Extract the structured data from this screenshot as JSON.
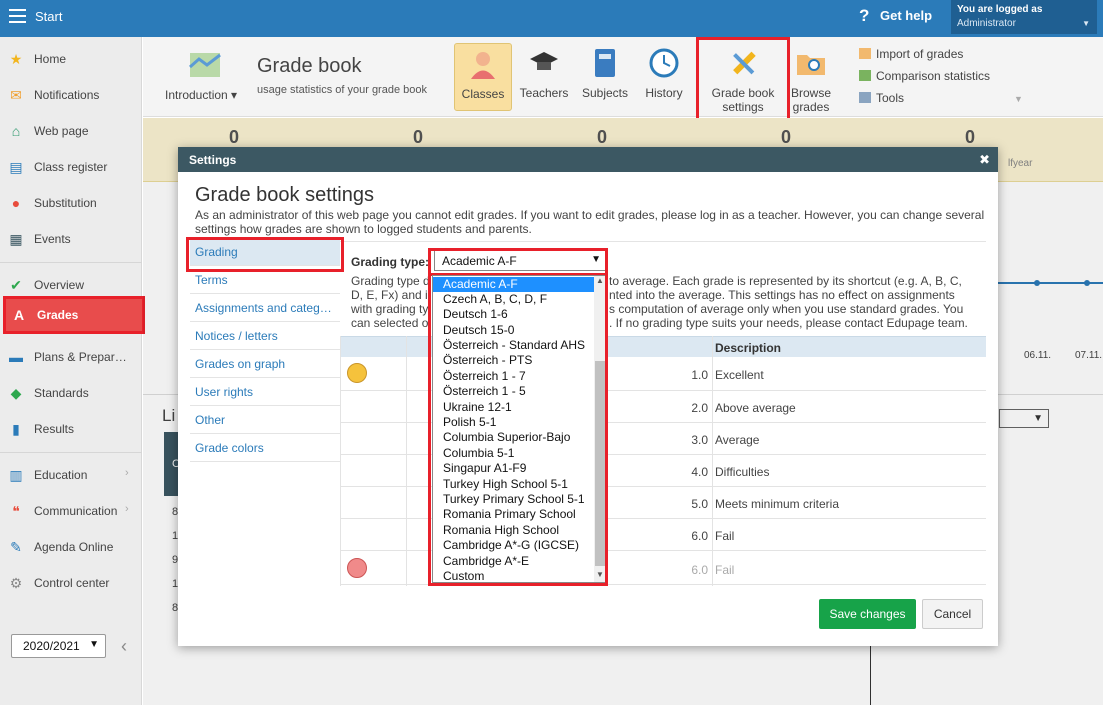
{
  "topbar": {
    "start_label": "Start",
    "help_label": "Get help",
    "login_line1": "You are logged as",
    "login_line2": "Administrator"
  },
  "sidebar": {
    "items": [
      {
        "label": "Home",
        "icon": "star-icon"
      },
      {
        "label": "Notifications",
        "icon": "envelope-icon"
      },
      {
        "label": "Web page",
        "icon": "house-icon"
      },
      {
        "label": "Class register",
        "icon": "register-icon"
      },
      {
        "label": "Substitution",
        "icon": "person-icon"
      },
      {
        "label": "Events",
        "icon": "calendar-icon"
      },
      {
        "label": "Overview",
        "icon": "check-circle-icon"
      },
      {
        "label": "Grades",
        "icon": "grade-icon"
      },
      {
        "label": "Plans & Prepar…",
        "icon": "plans-icon"
      },
      {
        "label": "Standards",
        "icon": "shield-check-icon"
      },
      {
        "label": "Results",
        "icon": "bar-chart-icon"
      },
      {
        "label": "Education",
        "icon": "book-icon"
      },
      {
        "label": "Communication",
        "icon": "chat-icon"
      },
      {
        "label": "Agenda Online",
        "icon": "pen-icon"
      },
      {
        "label": "Control center",
        "icon": "gear-icon"
      }
    ],
    "year": "2020/2021"
  },
  "ribbon": {
    "introduction": "Introduction",
    "title": "Grade book",
    "subtitle": "usage statistics of your grade book",
    "classes": "Classes",
    "teachers": "Teachers",
    "subjects": "Subjects",
    "history": "History",
    "gradebook_settings_1": "Grade book",
    "gradebook_settings_2": "settings",
    "browse_grades_1": "Browse",
    "browse_grades_2": "grades",
    "import_grades": "Import of grades",
    "comparison_statistics": "Comparison statistics",
    "tools": "Tools"
  },
  "stats": {
    "values": [
      "0",
      "0",
      "0",
      "0",
      "0"
    ],
    "halfyear": "lfyear"
  },
  "background": {
    "date1": "06.11.",
    "date2": "07.11.",
    "li": "Li",
    "col_c": "C",
    "rows": [
      "8",
      "1",
      "9",
      "1",
      "8"
    ]
  },
  "modal": {
    "header": "Settings",
    "title": "Grade book settings",
    "description": "As an administrator of this web page you cannot edit grades. If you want to edit grades, please log in as a teacher. However, you can change several settings how grades are shown to logged students and parents.",
    "tabs": [
      "Grading",
      "Terms",
      "Assignments and categ…",
      "Notices / letters",
      "Grades on graph",
      "User rights",
      "Other",
      "Grade colors"
    ],
    "grading_type_label": "Grading type:",
    "grading_type_value": "Academic A-F",
    "grading_desc": {
      "l1a": "Grading type d",
      "l1b": "to average. Each grade is represented by its shortcut (e.g. A, B, C,",
      "l2a": "D, E, Fx) and i",
      "l2b": "nted into the average. This settings has no effect on assignments",
      "l3a": "with grading ty",
      "l3b": "s computation of average only when you use standard grades. You",
      "l4a": "can selected o",
      "l4b": ". If no grading type suits your needs, please contact Edupage team."
    },
    "table_header_description": "Description",
    "grades": [
      {
        "value": "1.0",
        "desc": "Excellent"
      },
      {
        "value": "2.0",
        "desc": "Above average"
      },
      {
        "value": "3.0",
        "desc": "Average"
      },
      {
        "value": "4.0",
        "desc": "Difficulties"
      },
      {
        "value": "5.0",
        "desc": "Meets minimum criteria"
      },
      {
        "value": "6.0",
        "desc": "Fail"
      },
      {
        "value": "6.0",
        "desc": "Fail"
      }
    ],
    "save_label": "Save changes",
    "cancel_label": "Cancel"
  },
  "dropdown_options": [
    "Academic A-F",
    "Czech A, B, C, D, F",
    "Deutsch 1-6",
    "Deutsch 15-0",
    "Österreich - Standard AHS",
    "Österreich - PTS",
    "Österreich 1 - 7",
    "Österreich 1 - 5",
    "Ukraine 12-1",
    "Polish 5-1",
    "Columbia Superior-Bajo",
    "Columbia 5-1",
    "Singapur A1-F9",
    "Turkey High School 5-1",
    "Turkey Primary School 5-1",
    "Romania Primary School",
    "Romania High School",
    "Cambridge A*-G (IGCSE)",
    "Cambridge A*-E",
    "Custom"
  ],
  "colors": {
    "topbar": "#2b7bb9",
    "highlight": "#e8202a",
    "save": "#17a349",
    "selected_option": "#1e90ff"
  }
}
